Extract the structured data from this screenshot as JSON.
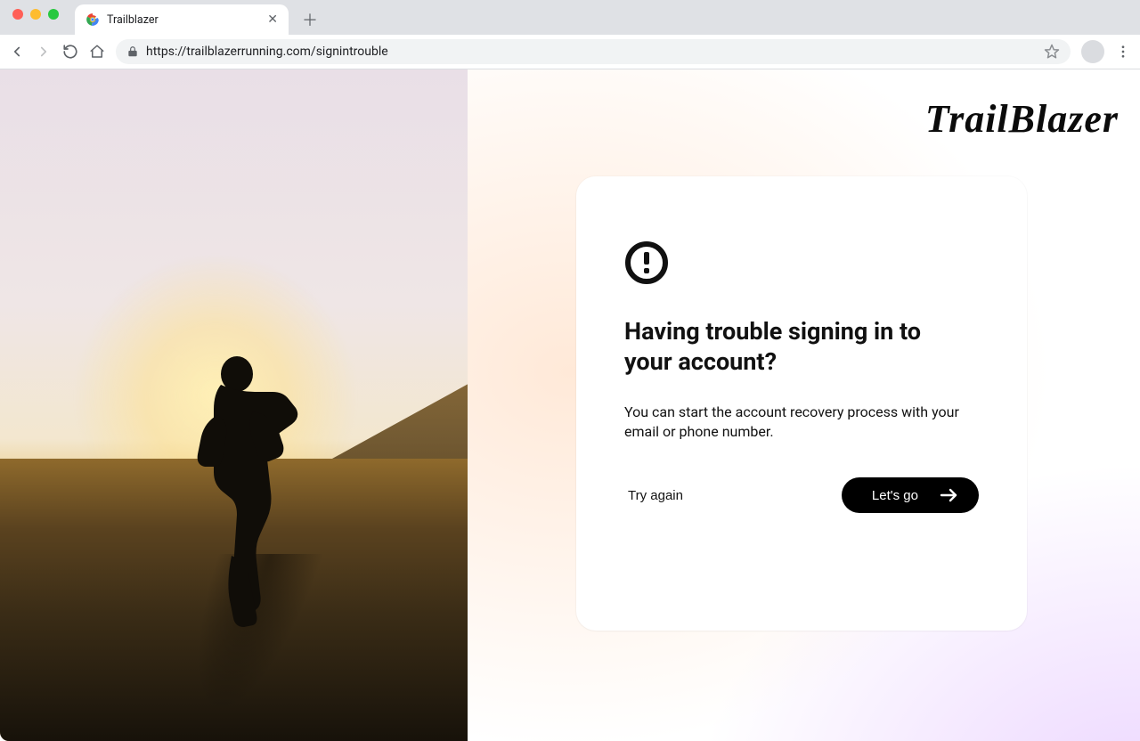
{
  "browser": {
    "tab_title": "Trailblazer",
    "url": "https://trailblazerrunning.com/signintrouble"
  },
  "brand": {
    "logo_text": "TrailBlazer"
  },
  "card": {
    "heading": "Having trouble signing in to your account?",
    "body": "You can start the account recovery process with your email or phone number.",
    "try_again_label": "Try again",
    "lets_go_label": "Let's go"
  }
}
